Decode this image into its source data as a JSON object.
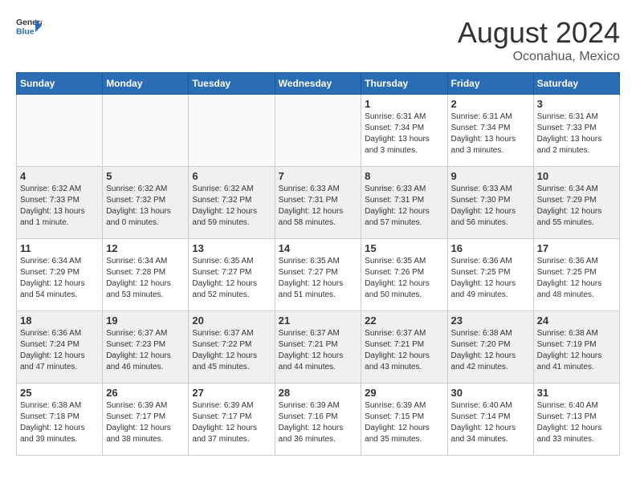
{
  "header": {
    "logo_line1": "General",
    "logo_line2": "Blue",
    "month_year": "August 2024",
    "location": "Oconahua, Mexico"
  },
  "days_of_week": [
    "Sunday",
    "Monday",
    "Tuesday",
    "Wednesday",
    "Thursday",
    "Friday",
    "Saturday"
  ],
  "weeks": [
    [
      {
        "day": "",
        "info": ""
      },
      {
        "day": "",
        "info": ""
      },
      {
        "day": "",
        "info": ""
      },
      {
        "day": "",
        "info": ""
      },
      {
        "day": "1",
        "info": "Sunrise: 6:31 AM\nSunset: 7:34 PM\nDaylight: 13 hours\nand 3 minutes."
      },
      {
        "day": "2",
        "info": "Sunrise: 6:31 AM\nSunset: 7:34 PM\nDaylight: 13 hours\nand 3 minutes."
      },
      {
        "day": "3",
        "info": "Sunrise: 6:31 AM\nSunset: 7:33 PM\nDaylight: 13 hours\nand 2 minutes."
      }
    ],
    [
      {
        "day": "4",
        "info": "Sunrise: 6:32 AM\nSunset: 7:33 PM\nDaylight: 13 hours\nand 1 minute."
      },
      {
        "day": "5",
        "info": "Sunrise: 6:32 AM\nSunset: 7:32 PM\nDaylight: 13 hours\nand 0 minutes."
      },
      {
        "day": "6",
        "info": "Sunrise: 6:32 AM\nSunset: 7:32 PM\nDaylight: 12 hours\nand 59 minutes."
      },
      {
        "day": "7",
        "info": "Sunrise: 6:33 AM\nSunset: 7:31 PM\nDaylight: 12 hours\nand 58 minutes."
      },
      {
        "day": "8",
        "info": "Sunrise: 6:33 AM\nSunset: 7:31 PM\nDaylight: 12 hours\nand 57 minutes."
      },
      {
        "day": "9",
        "info": "Sunrise: 6:33 AM\nSunset: 7:30 PM\nDaylight: 12 hours\nand 56 minutes."
      },
      {
        "day": "10",
        "info": "Sunrise: 6:34 AM\nSunset: 7:29 PM\nDaylight: 12 hours\nand 55 minutes."
      }
    ],
    [
      {
        "day": "11",
        "info": "Sunrise: 6:34 AM\nSunset: 7:29 PM\nDaylight: 12 hours\nand 54 minutes."
      },
      {
        "day": "12",
        "info": "Sunrise: 6:34 AM\nSunset: 7:28 PM\nDaylight: 12 hours\nand 53 minutes."
      },
      {
        "day": "13",
        "info": "Sunrise: 6:35 AM\nSunset: 7:27 PM\nDaylight: 12 hours\nand 52 minutes."
      },
      {
        "day": "14",
        "info": "Sunrise: 6:35 AM\nSunset: 7:27 PM\nDaylight: 12 hours\nand 51 minutes."
      },
      {
        "day": "15",
        "info": "Sunrise: 6:35 AM\nSunset: 7:26 PM\nDaylight: 12 hours\nand 50 minutes."
      },
      {
        "day": "16",
        "info": "Sunrise: 6:36 AM\nSunset: 7:25 PM\nDaylight: 12 hours\nand 49 minutes."
      },
      {
        "day": "17",
        "info": "Sunrise: 6:36 AM\nSunset: 7:25 PM\nDaylight: 12 hours\nand 48 minutes."
      }
    ],
    [
      {
        "day": "18",
        "info": "Sunrise: 6:36 AM\nSunset: 7:24 PM\nDaylight: 12 hours\nand 47 minutes."
      },
      {
        "day": "19",
        "info": "Sunrise: 6:37 AM\nSunset: 7:23 PM\nDaylight: 12 hours\nand 46 minutes."
      },
      {
        "day": "20",
        "info": "Sunrise: 6:37 AM\nSunset: 7:22 PM\nDaylight: 12 hours\nand 45 minutes."
      },
      {
        "day": "21",
        "info": "Sunrise: 6:37 AM\nSunset: 7:21 PM\nDaylight: 12 hours\nand 44 minutes."
      },
      {
        "day": "22",
        "info": "Sunrise: 6:37 AM\nSunset: 7:21 PM\nDaylight: 12 hours\nand 43 minutes."
      },
      {
        "day": "23",
        "info": "Sunrise: 6:38 AM\nSunset: 7:20 PM\nDaylight: 12 hours\nand 42 minutes."
      },
      {
        "day": "24",
        "info": "Sunrise: 6:38 AM\nSunset: 7:19 PM\nDaylight: 12 hours\nand 41 minutes."
      }
    ],
    [
      {
        "day": "25",
        "info": "Sunrise: 6:38 AM\nSunset: 7:18 PM\nDaylight: 12 hours\nand 39 minutes."
      },
      {
        "day": "26",
        "info": "Sunrise: 6:39 AM\nSunset: 7:17 PM\nDaylight: 12 hours\nand 38 minutes."
      },
      {
        "day": "27",
        "info": "Sunrise: 6:39 AM\nSunset: 7:17 PM\nDaylight: 12 hours\nand 37 minutes."
      },
      {
        "day": "28",
        "info": "Sunrise: 6:39 AM\nSunset: 7:16 PM\nDaylight: 12 hours\nand 36 minutes."
      },
      {
        "day": "29",
        "info": "Sunrise: 6:39 AM\nSunset: 7:15 PM\nDaylight: 12 hours\nand 35 minutes."
      },
      {
        "day": "30",
        "info": "Sunrise: 6:40 AM\nSunset: 7:14 PM\nDaylight: 12 hours\nand 34 minutes."
      },
      {
        "day": "31",
        "info": "Sunrise: 6:40 AM\nSunset: 7:13 PM\nDaylight: 12 hours\nand 33 minutes."
      }
    ]
  ]
}
